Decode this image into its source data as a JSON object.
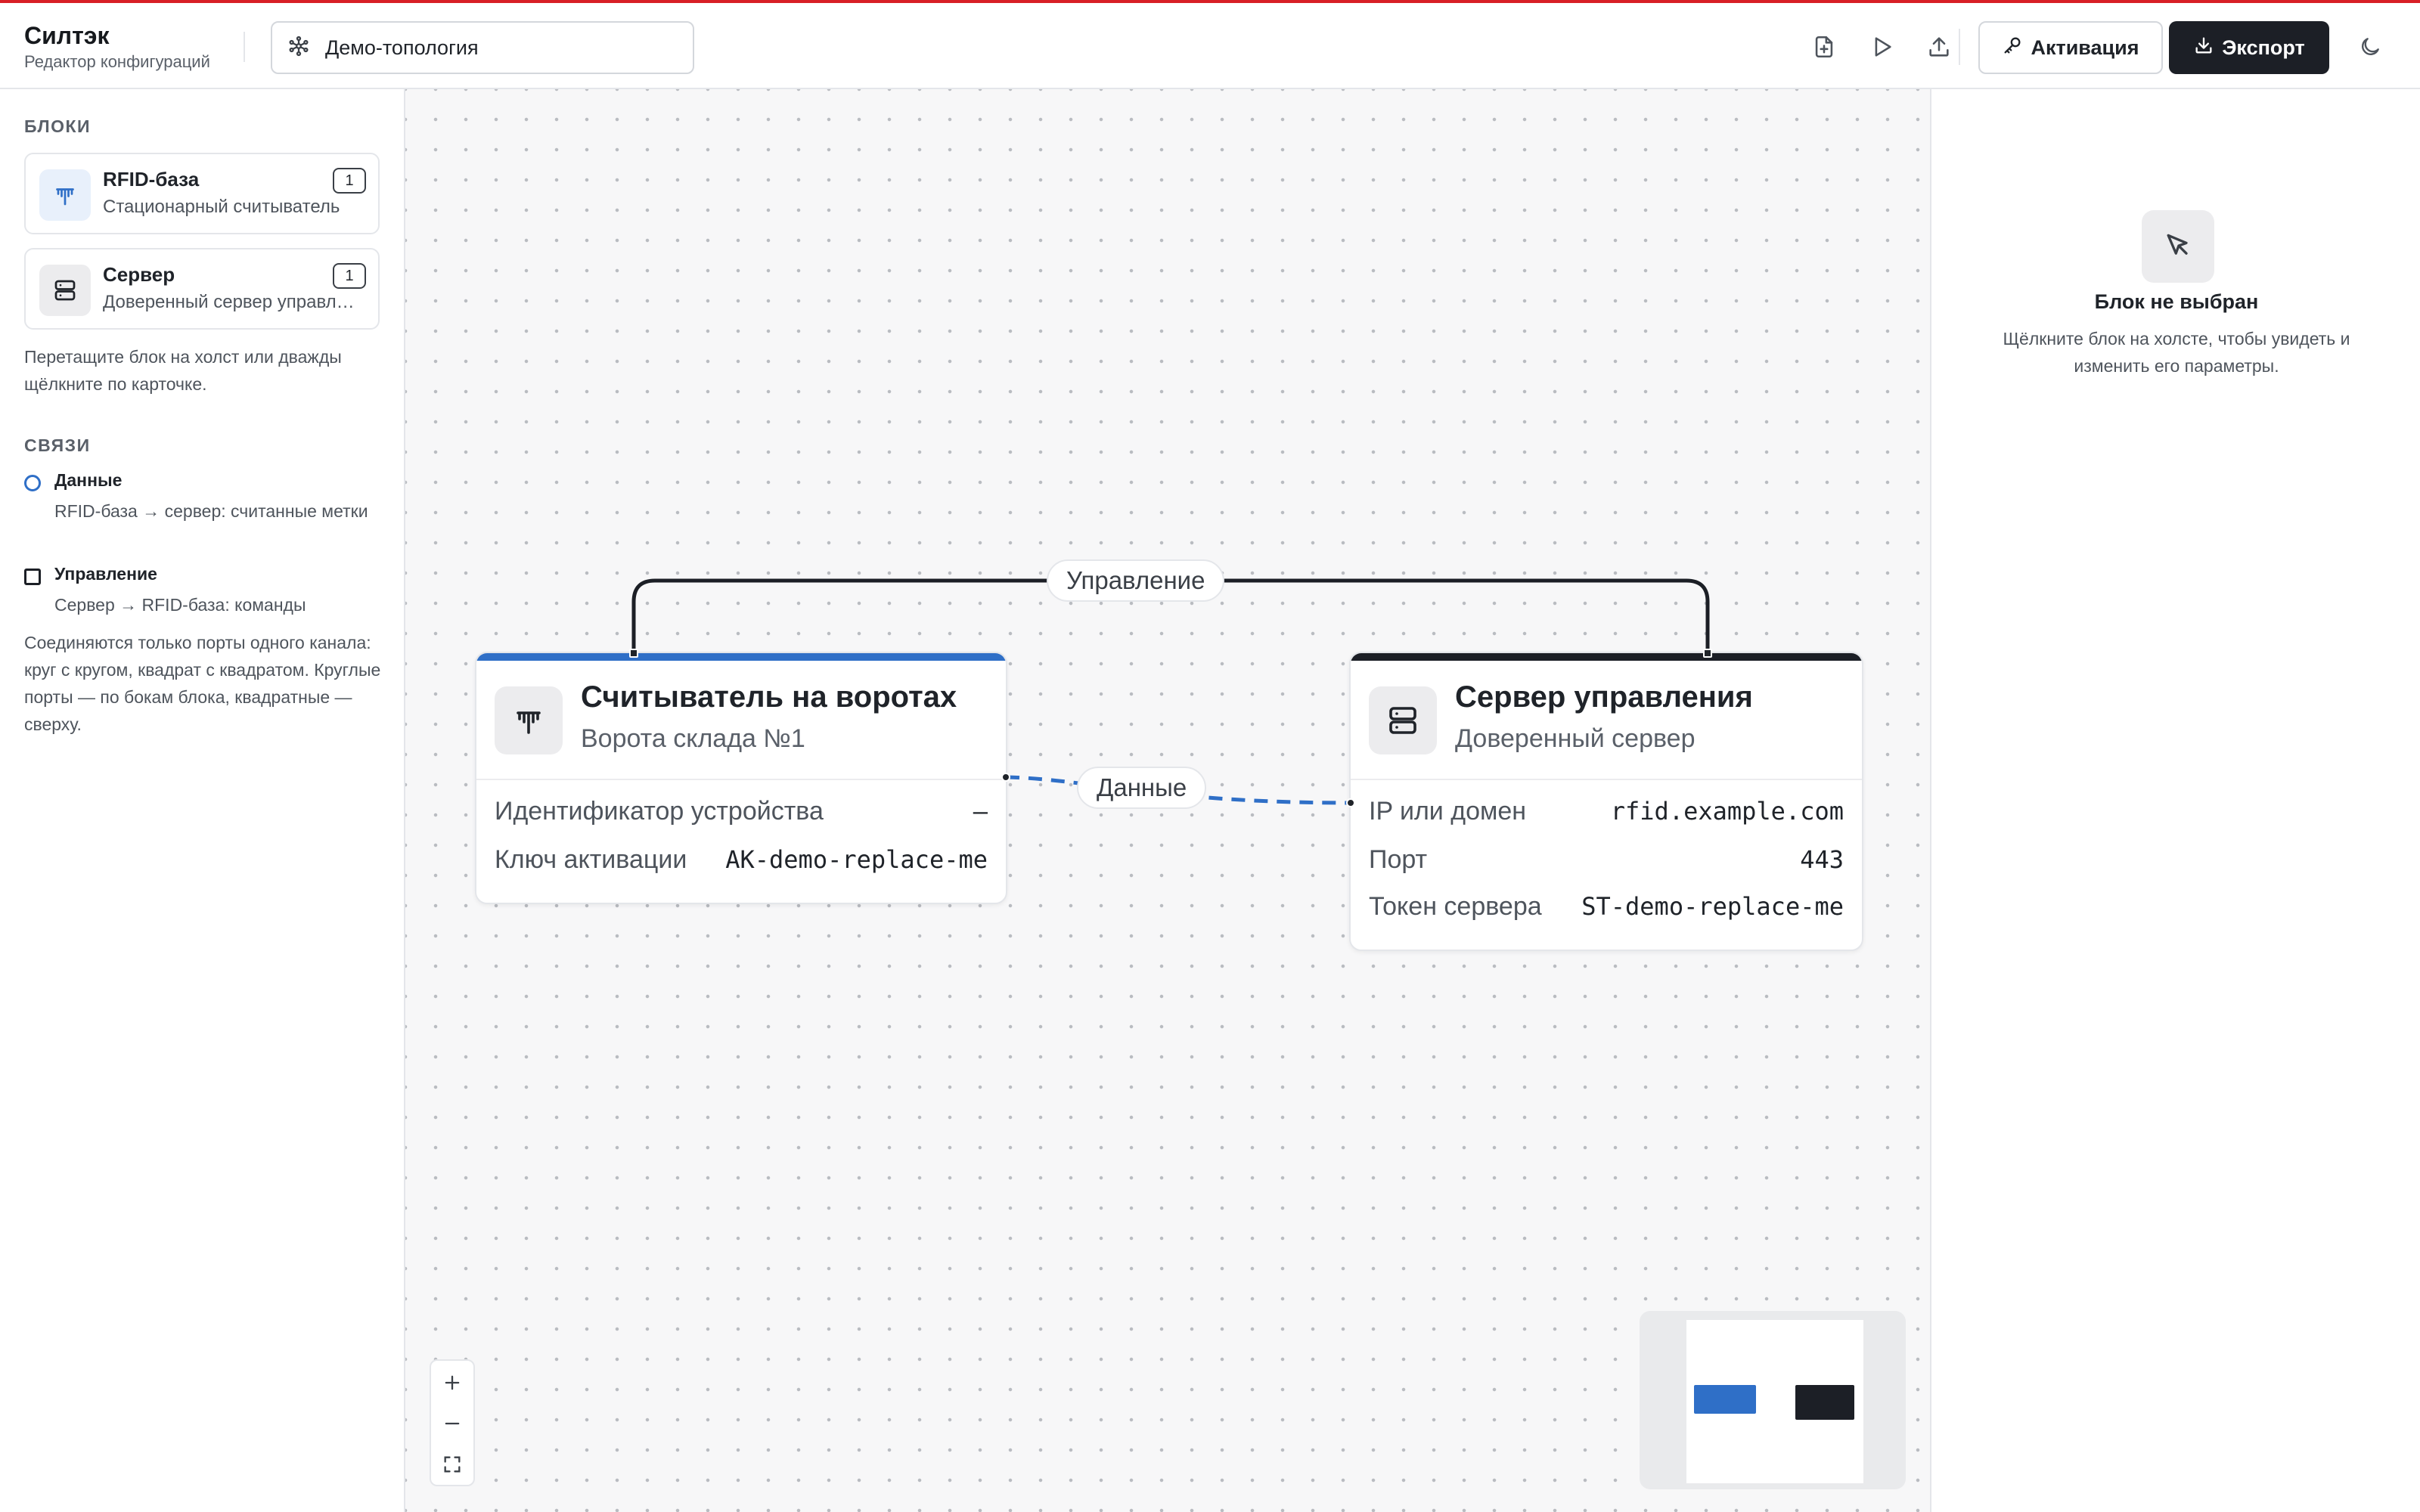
{
  "header": {
    "brand_title": "Силтэк",
    "brand_subtitle": "Редактор конфигураций",
    "project_name": "Демо-топология",
    "activation_label": "Активация",
    "export_label": "Экспорт",
    "icons": [
      "new-file-icon",
      "play-icon",
      "upload-icon",
      "key-icon",
      "download-icon",
      "moon-icon"
    ]
  },
  "sidebar": {
    "blocks_title": "БЛОКИ",
    "blocks": [
      {
        "name": "RFID-база",
        "desc": "Стационарный считыватель",
        "count": "1",
        "icon": "antenna-icon",
        "icon_bg": "#e8f0fb",
        "icon_color": "#2f6fc7"
      },
      {
        "name": "Сервер",
        "desc": "Доверенный сервер управления",
        "count": "1",
        "icon": "server-icon",
        "icon_bg": "#ececee",
        "icon_color": "#1f2329"
      }
    ],
    "blocks_hint": "Перетащите блок на холст или дважды щёлкните по карточке.",
    "links_title": "СВЯЗИ",
    "links": [
      {
        "name": "Данные",
        "desc": "RFID-база → сервер: считанные метки",
        "marker": "circle"
      },
      {
        "name": "Управление",
        "desc": "Сервер → RFID-база: команды",
        "marker": "square"
      }
    ],
    "links_hint": "Соединяются только порты одного канала: круг с кругом, квадрат с квадратом. Круглые порты — по бокам блока, квадратные — сверху."
  },
  "canvas": {
    "edges": {
      "control_label": "Управление",
      "data_label": "Данные"
    },
    "nodes": {
      "reader": {
        "title": "Считыватель на воротах",
        "subtitle": "Ворота склада №1",
        "accent": "#2f6fc7",
        "props": [
          {
            "label": "Идентификатор устройства",
            "value": "—"
          },
          {
            "label": "Ключ активации",
            "value": "AK-demo-replace-me"
          }
        ]
      },
      "server": {
        "title": "Сервер управления",
        "subtitle": "Доверенный сервер",
        "accent": "#1c1f26",
        "props": [
          {
            "label": "IP или домен",
            "value": "rfid.example.com"
          },
          {
            "label": "Порт",
            "value": "443"
          },
          {
            "label": "Токен сервера",
            "value": "ST-demo-replace-me"
          }
        ]
      }
    },
    "colors": {
      "data_edge": "#2f6fc7",
      "control_edge": "#1c1f26"
    }
  },
  "right_panel": {
    "empty_title": "Блок не выбран",
    "empty_text": "Щёлкните блок на холсте, чтобы увидеть и изменить его параметры."
  }
}
